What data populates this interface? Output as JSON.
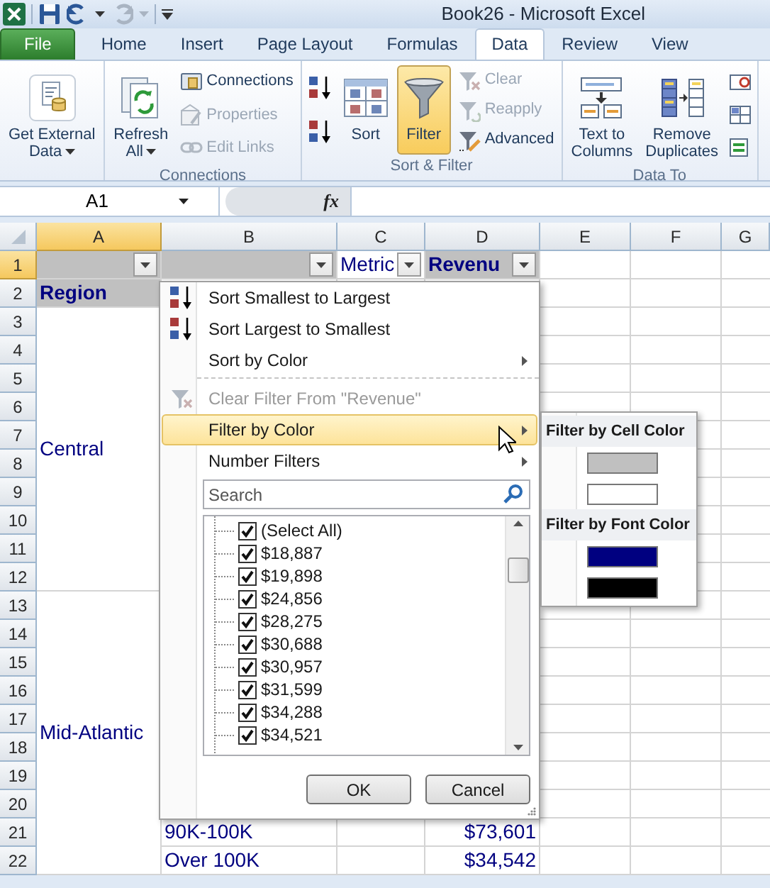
{
  "window": {
    "title": "Book26  -  Microsoft Excel"
  },
  "quick_access": [
    {
      "kind": "save",
      "disabled": false
    },
    {
      "kind": "undo",
      "disabled": false
    },
    {
      "kind": "redo",
      "disabled": true
    }
  ],
  "tabs": [
    {
      "label": "File",
      "kind": "file",
      "selected": false
    },
    {
      "label": "Home",
      "kind": "tab",
      "selected": false
    },
    {
      "label": "Insert",
      "kind": "tab",
      "selected": false
    },
    {
      "label": "Page Layout",
      "kind": "tab",
      "selected": false
    },
    {
      "label": "Formulas",
      "kind": "tab",
      "selected": false
    },
    {
      "label": "Data",
      "kind": "tab",
      "selected": true
    },
    {
      "label": "Review",
      "kind": "tab",
      "selected": false
    },
    {
      "label": "View",
      "kind": "tab",
      "selected": false
    }
  ],
  "ribbon_groups": [
    {
      "items": [
        {
          "kind": "large",
          "lines": [
            "Get External",
            "Data"
          ],
          "dropdown": true,
          "pressed": false
        }
      ]
    },
    {
      "label": "Connections",
      "items": [
        {
          "kind": "large",
          "lines": [
            "Refresh",
            "All"
          ],
          "dropdown": true,
          "pressed": false
        },
        {
          "kind": "small",
          "label": "Connections",
          "disabled": false
        },
        {
          "kind": "small",
          "label": "Properties",
          "disabled": true
        },
        {
          "kind": "small",
          "label": "Edit Links",
          "disabled": true
        }
      ]
    },
    {
      "label": "Sort & Filter",
      "items": [
        {
          "kind": "icon"
        },
        {
          "kind": "icon"
        },
        {
          "kind": "large",
          "lines": [
            "Sort"
          ],
          "dropdown": false,
          "pressed": false
        },
        {
          "kind": "large",
          "lines": [
            "Filter"
          ],
          "dropdown": false,
          "pressed": true
        },
        {
          "kind": "small",
          "label": "Clear",
          "disabled": true
        },
        {
          "kind": "small",
          "label": "Reapply",
          "disabled": true
        },
        {
          "kind": "small",
          "label": "Advanced",
          "disabled": false
        }
      ]
    },
    {
      "label": "Data To",
      "items": [
        {
          "kind": "large",
          "lines": [
            "Text to",
            "Columns"
          ],
          "dropdown": false,
          "pressed": false
        },
        {
          "kind": "large",
          "lines": [
            "Remove",
            "Duplicates"
          ],
          "dropdown": false,
          "pressed": false
        },
        {
          "kind": "icon"
        },
        {
          "kind": "icon"
        },
        {
          "kind": "icon"
        }
      ]
    }
  ],
  "formula_bar": {
    "name_box": "A1",
    "function_label": "fx"
  },
  "sheet": {
    "columns": [
      {
        "label": "A",
        "selected": true
      },
      {
        "label": "B",
        "selected": false
      },
      {
        "label": "C",
        "selected": false
      },
      {
        "label": "D",
        "selected": false
      },
      {
        "label": "E",
        "selected": false
      },
      {
        "label": "F",
        "selected": false
      },
      {
        "label": "G",
        "selected": false
      }
    ],
    "rows": [
      {
        "header": "1",
        "selected": true,
        "cells": [
          {
            "shaded": true,
            "filter": true
          },
          {
            "shaded": true,
            "filter": true
          },
          {
            "text": "Metric",
            "shaded": false,
            "filter": true
          },
          {
            "text": "Revenu",
            "shaded": true,
            "filter": true,
            "bold": true
          }
        ]
      },
      {
        "header": "2",
        "selected": false,
        "cells": [
          {
            "text": "Region",
            "shaded": true,
            "filter": false,
            "bold": true
          }
        ]
      },
      {
        "header": "3",
        "selected": false,
        "cells": [
          {
            "text": "Central",
            "merged_down": true
          }
        ]
      },
      {
        "header": "4",
        "selected": false
      },
      {
        "header": "5",
        "selected": false
      },
      {
        "header": "6",
        "selected": false
      },
      {
        "header": "7",
        "selected": false
      },
      {
        "header": "8",
        "selected": false
      },
      {
        "header": "9",
        "selected": false
      },
      {
        "header": "10",
        "selected": false
      },
      {
        "header": "11",
        "selected": false
      },
      {
        "header": "12",
        "selected": false
      },
      {
        "header": "13",
        "selected": false,
        "cells": [
          {
            "text": "Mid-Atlantic",
            "merged_down": true
          }
        ]
      },
      {
        "header": "14",
        "selected": false
      },
      {
        "header": "15",
        "selected": false
      },
      {
        "header": "16",
        "selected": false
      },
      {
        "header": "17",
        "selected": false
      },
      {
        "header": "18",
        "selected": false
      },
      {
        "header": "19",
        "selected": false
      },
      {
        "header": "20",
        "selected": false
      },
      {
        "header": "21",
        "selected": false,
        "cells": [
          {},
          {
            "text": "90K-100K"
          },
          {},
          {
            "text": "$73,601",
            "kind": "number"
          }
        ]
      },
      {
        "header": "22",
        "selected": false,
        "cells": [
          {},
          {
            "text": "Over 100K"
          },
          {},
          {
            "text": "$34,542",
            "kind": "number"
          }
        ]
      }
    ]
  },
  "filter_menu": {
    "items": [
      {
        "kind": "sort_asc",
        "label": "Sort Smallest to Largest",
        "disabled": false,
        "selected": false,
        "submenu": false
      },
      {
        "kind": "sort_desc",
        "label": "Sort Largest to Smallest",
        "disabled": false,
        "selected": false,
        "submenu": false
      },
      {
        "kind": "plain",
        "label": "Sort by Color",
        "disabled": false,
        "selected": false,
        "submenu": true
      },
      {
        "kind": "separator"
      },
      {
        "kind": "clear_filter",
        "label": "Clear Filter From \"Revenue\"",
        "disabled": true,
        "selected": false,
        "submenu": false
      },
      {
        "kind": "plain",
        "label": "Filter by Color",
        "disabled": false,
        "selected": true,
        "submenu": true
      },
      {
        "kind": "plain",
        "label": "Number Filters",
        "disabled": false,
        "selected": false,
        "submenu": true
      }
    ],
    "search": {
      "placeholder": "Search"
    },
    "values": [
      {
        "label": "(Select All)",
        "checked": true
      },
      {
        "label": "$18,887",
        "checked": true
      },
      {
        "label": "$19,898",
        "checked": true
      },
      {
        "label": "$24,856",
        "checked": true
      },
      {
        "label": "$28,275",
        "checked": true
      },
      {
        "label": "$30,688",
        "checked": true
      },
      {
        "label": "$30,957",
        "checked": true
      },
      {
        "label": "$31,599",
        "checked": true
      },
      {
        "label": "$34,288",
        "checked": true
      },
      {
        "label": "$34,521",
        "checked": true
      }
    ],
    "buttons": [
      "OK",
      "Cancel"
    ]
  },
  "color_submenu": {
    "sections": [
      {
        "title": "Filter by Cell Color",
        "swatches": [
          {
            "color": "#c0c0c0"
          },
          {
            "color": "#ffffff"
          }
        ]
      },
      {
        "title": "Filter by Font Color",
        "swatches": [
          {
            "color": "#000080"
          },
          {
            "color": "#000000"
          }
        ]
      }
    ]
  }
}
